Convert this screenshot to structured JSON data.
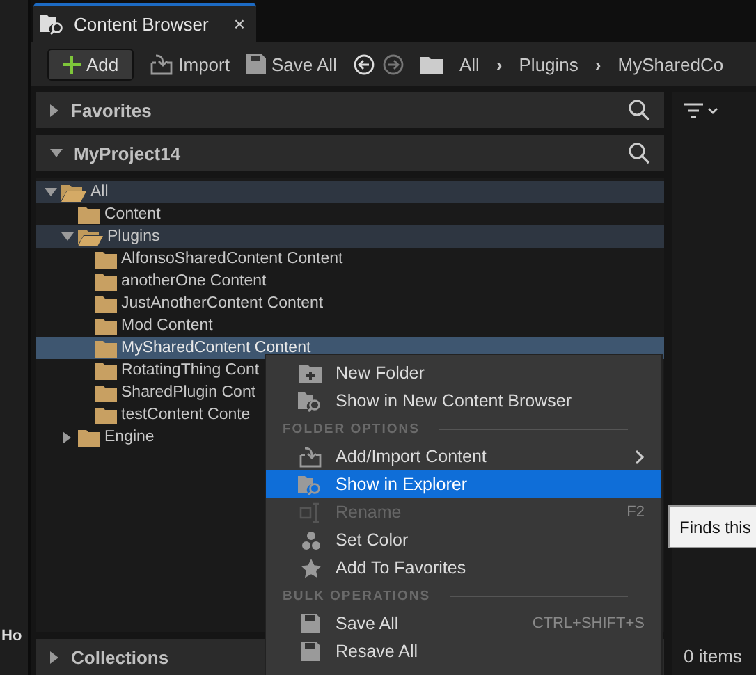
{
  "side_strip": {
    "label": "Ho"
  },
  "tab": {
    "title": "Content Browser",
    "close": "×"
  },
  "toolbar": {
    "buttons": [
      {
        "kind": "add",
        "label": "Add"
      },
      {
        "kind": "import",
        "label": "Import"
      },
      {
        "kind": "save",
        "label": "Save All"
      }
    ],
    "breadcrumb": [
      {
        "kind": "crumb",
        "label": "All"
      },
      {
        "kind": "sep",
        "label": "›"
      },
      {
        "kind": "crumb",
        "label": "Plugins"
      },
      {
        "kind": "sep",
        "label": "›"
      },
      {
        "kind": "crumb",
        "label": "MySharedCo"
      }
    ]
  },
  "sections": {
    "favorites": {
      "title": "Favorites",
      "expanded": false
    },
    "project": {
      "title": "MyProject14",
      "expanded": true
    },
    "collections": {
      "title": "Collections",
      "expanded": false
    }
  },
  "tree": [
    {
      "label": "All",
      "expanded": true,
      "selected": false,
      "on_path": true,
      "children": [
        {
          "label": "Content",
          "expanded": false,
          "selected": false,
          "on_path": false
        },
        {
          "label": "Plugins",
          "expanded": true,
          "selected": false,
          "on_path": true,
          "children": [
            {
              "label": "AlfonsoSharedContent Content",
              "selected": false,
              "on_path": false
            },
            {
              "label": "anotherOne Content",
              "selected": false,
              "on_path": false
            },
            {
              "label": "JustAnotherContent Content",
              "selected": false,
              "on_path": false
            },
            {
              "label": "Mod Content",
              "selected": false,
              "on_path": false
            },
            {
              "label": "MySharedContent Content",
              "selected": true,
              "on_path": false
            },
            {
              "label": "RotatingThing Cont",
              "selected": false,
              "on_path": false
            },
            {
              "label": "SharedPlugin Cont",
              "selected": false,
              "on_path": false
            },
            {
              "label": "testContent Conte",
              "selected": false,
              "on_path": false
            }
          ]
        },
        {
          "label": "Engine",
          "expanded": false,
          "has_children": true,
          "selected": false,
          "on_path": false
        }
      ]
    }
  ],
  "status": {
    "items": "0 items"
  },
  "menu": [
    {
      "kind": "newfolder",
      "label": "New Folder",
      "selected": false,
      "disabled": false
    },
    {
      "kind": "browse",
      "label": "Show in New Content Browser",
      "selected": false,
      "disabled": false
    },
    {
      "kind": "header",
      "label": "FOLDER OPTIONS"
    },
    {
      "kind": "import",
      "label": "Add/Import Content",
      "submenu": true,
      "selected": false,
      "disabled": false
    },
    {
      "kind": "explore",
      "label": "Show in Explorer",
      "selected": true,
      "disabled": false
    },
    {
      "kind": "rename",
      "label": "Rename",
      "shortcut": "F2",
      "selected": false,
      "disabled": true
    },
    {
      "kind": "color",
      "label": "Set Color",
      "selected": false,
      "disabled": false
    },
    {
      "kind": "favorite",
      "label": "Add To Favorites",
      "selected": false,
      "disabled": false
    },
    {
      "kind": "header",
      "label": "BULK OPERATIONS"
    },
    {
      "kind": "save",
      "label": "Save All",
      "shortcut": "CTRL+SHIFT+S",
      "selected": false,
      "disabled": false
    },
    {
      "kind": "resave",
      "label": "Resave All",
      "selected": false,
      "disabled": false
    }
  ],
  "tooltip": {
    "text": "Finds this"
  }
}
